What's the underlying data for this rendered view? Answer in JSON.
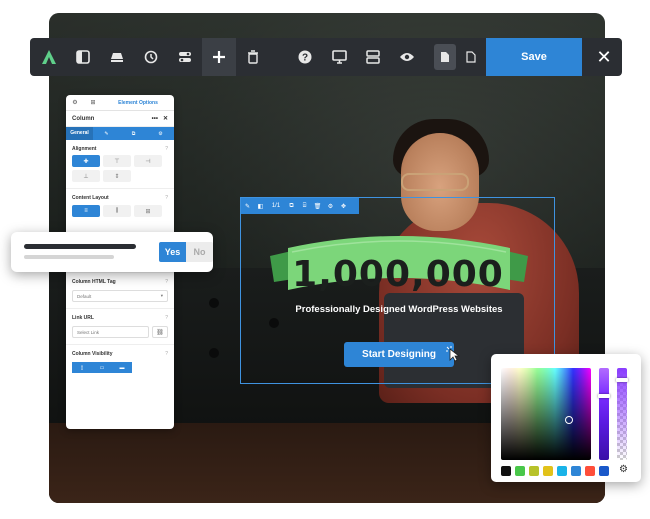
{
  "toolbar": {
    "logo_icon": "builder-logo-icon",
    "tools": [
      {
        "name": "panel-icon",
        "glyph": "▮"
      },
      {
        "name": "templates-icon",
        "glyph": "⌸"
      },
      {
        "name": "history-icon",
        "glyph": "◷"
      },
      {
        "name": "toggle-icon",
        "glyph": "⊜"
      },
      {
        "name": "add-icon",
        "glyph": "+"
      },
      {
        "name": "trash-icon",
        "glyph": "🗑"
      },
      {
        "name": "help-icon",
        "glyph": "?"
      },
      {
        "name": "desktop-icon",
        "glyph": "▭"
      },
      {
        "name": "layout-icon",
        "glyph": "☰"
      },
      {
        "name": "preview-icon",
        "glyph": "◉"
      }
    ],
    "save_label": "Save",
    "close_glyph": "✕"
  },
  "panel": {
    "top_tab_label": "Element Options",
    "title": "Column",
    "more_glyph": "•••",
    "close_glyph": "✕",
    "subtabs": [
      "General",
      "✎",
      "⧉",
      "⚙"
    ],
    "alignment_label": "Alignment",
    "content_layout_label": "Content Layout",
    "html_tag_label": "Column HTML Tag",
    "html_tag_value": "Default",
    "link_url_label": "Link URL",
    "link_placeholder": "Select Link",
    "visibility_label": "Column Visibility",
    "help_glyph": "?"
  },
  "toggle_card": {
    "yes_label": "Yes",
    "no_label": "No"
  },
  "selection_bar": {
    "count_label": "1/1"
  },
  "banner": {
    "count": "1,000,000",
    "tagline": "Professionally Designed WordPress Websites",
    "cta_label": "Start Designing",
    "ribbon_color": "#7cd67a",
    "ribbon_dark": "#3f9a48"
  },
  "colors": {
    "accent": "#2e85d6",
    "toolbar_bg": "#2b2e33"
  },
  "color_picker": {
    "swatches": [
      "#111111",
      "#49c74a",
      "#b7c22a",
      "#e2c21a",
      "#19b3e8",
      "#2e85d6",
      "#ff4e3a",
      "#1a58c9"
    ]
  }
}
